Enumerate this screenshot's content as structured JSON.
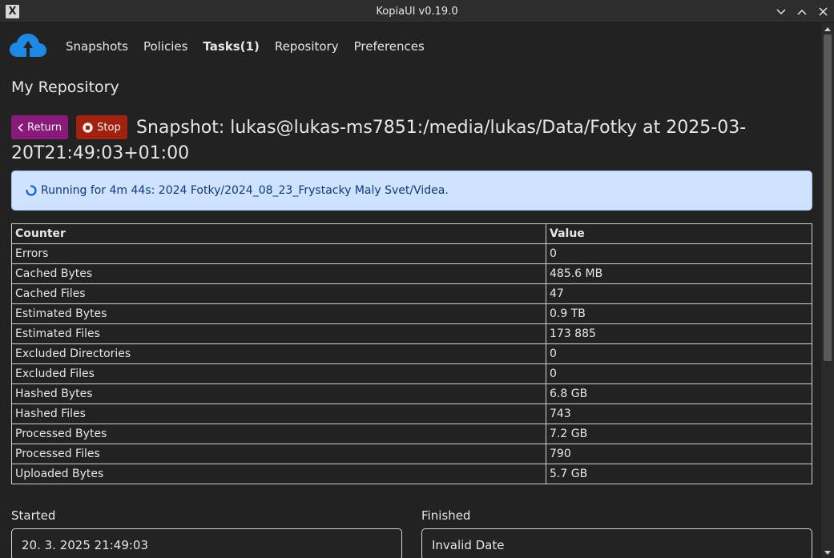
{
  "window": {
    "title": "KopiaUI v0.19.0",
    "icon_glyph": "X"
  },
  "nav": {
    "items": [
      {
        "label": "Snapshots"
      },
      {
        "label": "Policies"
      },
      {
        "label": "Tasks(1)"
      },
      {
        "label": "Repository"
      },
      {
        "label": "Preferences"
      }
    ],
    "active": "Tasks(1)",
    "logo": "cloud-upload-icon"
  },
  "page": {
    "title": "My Repository"
  },
  "task": {
    "return_label": "Return",
    "stop_label": "Stop",
    "title_line1": "Snapshot: lukas@lukas-ms7851:/media/lukas/Data/Fotky at 2025-03-",
    "title_line2": "20T21:49:03+01:00",
    "status": "Running for 4m 44s: 2024 Fotky/2024_08_23_Frystacky Maly Svet/Videa."
  },
  "counters": {
    "headers": [
      "Counter",
      "Value"
    ],
    "rows": [
      {
        "name": "Errors",
        "value": "0"
      },
      {
        "name": "Cached Bytes",
        "value": "485.6 MB"
      },
      {
        "name": "Cached Files",
        "value": "47"
      },
      {
        "name": "Estimated Bytes",
        "value": "0.9 TB"
      },
      {
        "name": "Estimated Files",
        "value": "173 885"
      },
      {
        "name": "Excluded Directories",
        "value": "0"
      },
      {
        "name": "Excluded Files",
        "value": "0"
      },
      {
        "name": "Hashed Bytes",
        "value": "6.8 GB"
      },
      {
        "name": "Hashed Files",
        "value": "743"
      },
      {
        "name": "Processed Bytes",
        "value": "7.2 GB"
      },
      {
        "name": "Processed Files",
        "value": "790"
      },
      {
        "name": "Uploaded Bytes",
        "value": "5.7 GB"
      }
    ]
  },
  "times": {
    "started_label": "Started",
    "started_value": "20. 3. 2025 21:49:03",
    "finished_label": "Finished",
    "finished_value": "Invalid Date"
  },
  "colors": {
    "return_button": "#8a1a7a",
    "stop_button": "#a3220f",
    "alert_background": "#cfe2ff",
    "logo_blue": "#1e88e5"
  }
}
